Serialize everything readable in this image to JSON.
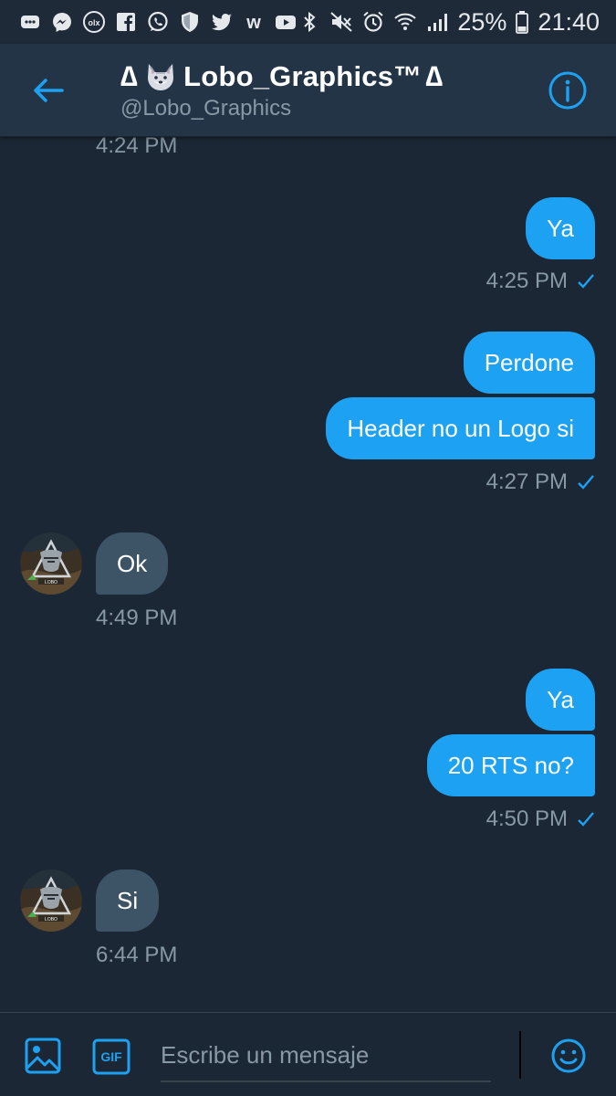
{
  "status_bar": {
    "battery": "25%",
    "time": "21:40",
    "left_icons": [
      "chat-icon",
      "messenger-icon",
      "olx-icon",
      "facebook-icon",
      "whatsapp-icon",
      "shield-icon",
      "twitter-icon",
      "wattpad-icon",
      "youtube-icon"
    ],
    "right_icons": [
      "bluetooth-icon",
      "mute-icon",
      "alarm-icon",
      "wifi-icon",
      "signal-icon",
      "battery-icon"
    ]
  },
  "header": {
    "title_prefix": "∆",
    "title_name": "Lobo_Graphics™",
    "title_suffix": "∆",
    "title_emoji": "wolf-emoji",
    "handle": "@Lobo_Graphics",
    "accent_color": "#1da1f2"
  },
  "messages": {
    "m0": {
      "time": "4:24 PM"
    },
    "m1": {
      "text": "Ya",
      "time": "4:25 PM"
    },
    "m2": {
      "text": "Perdone"
    },
    "m3": {
      "text": "Header no un Logo si",
      "time": "4:27 PM"
    },
    "m4": {
      "text": "Ok",
      "time": "4:49 PM"
    },
    "m5": {
      "text": "Ya"
    },
    "m6": {
      "text": "20 RTS no?",
      "time": "4:50 PM"
    },
    "m7": {
      "text": "Si",
      "time": "6:44 PM"
    }
  },
  "composer": {
    "placeholder": "Escribe un mensaje",
    "gif_label": "GIF"
  },
  "colors": {
    "background": "#1b2735",
    "header": "#243447",
    "outgoing_bubble": "#1da1f2",
    "incoming_bubble": "#3d5466",
    "muted_text": "#8899a6"
  }
}
